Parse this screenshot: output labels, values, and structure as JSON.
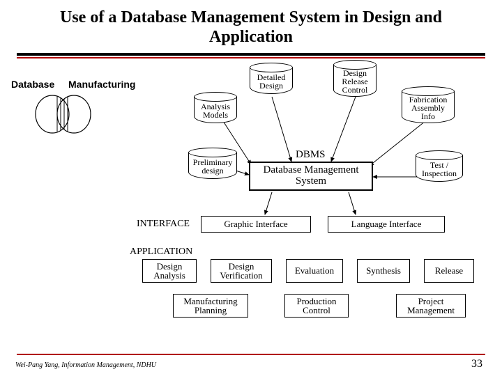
{
  "title": "Use of a Database Management System in Design and Application",
  "labels": {
    "database": "Database",
    "manufacturing": "Manufacturing",
    "dbms": "DBMS",
    "interface": "INTERFACE",
    "application": "APPLICATION"
  },
  "cylinders": {
    "detailed": "Detailed\nDesign",
    "analysis": "Analysis\nModels",
    "preliminary": "Preliminary\ndesign",
    "release": "Design\nRelease\nControl",
    "fab": "Fabrication\nAssembly\nInfo",
    "test": "Test /\nInspection"
  },
  "dbms_box": "Database Management\nSystem",
  "interface_row": {
    "graphic": "Graphic Interface",
    "language": "Language Interface"
  },
  "app_row1": {
    "design_analysis": "Design\nAnalysis",
    "design_verif": "Design\nVerification",
    "evaluation": "Evaluation",
    "synthesis": "Synthesis",
    "release": "Release"
  },
  "app_row2": {
    "mfg_plan": "Manufacturing\nPlanning",
    "prod_ctrl": "Production\nControl",
    "proj_mgmt": "Project\nManagement"
  },
  "footer": {
    "author": "Wei-Pang Yang, Information Management, NDHU",
    "page": "33"
  }
}
